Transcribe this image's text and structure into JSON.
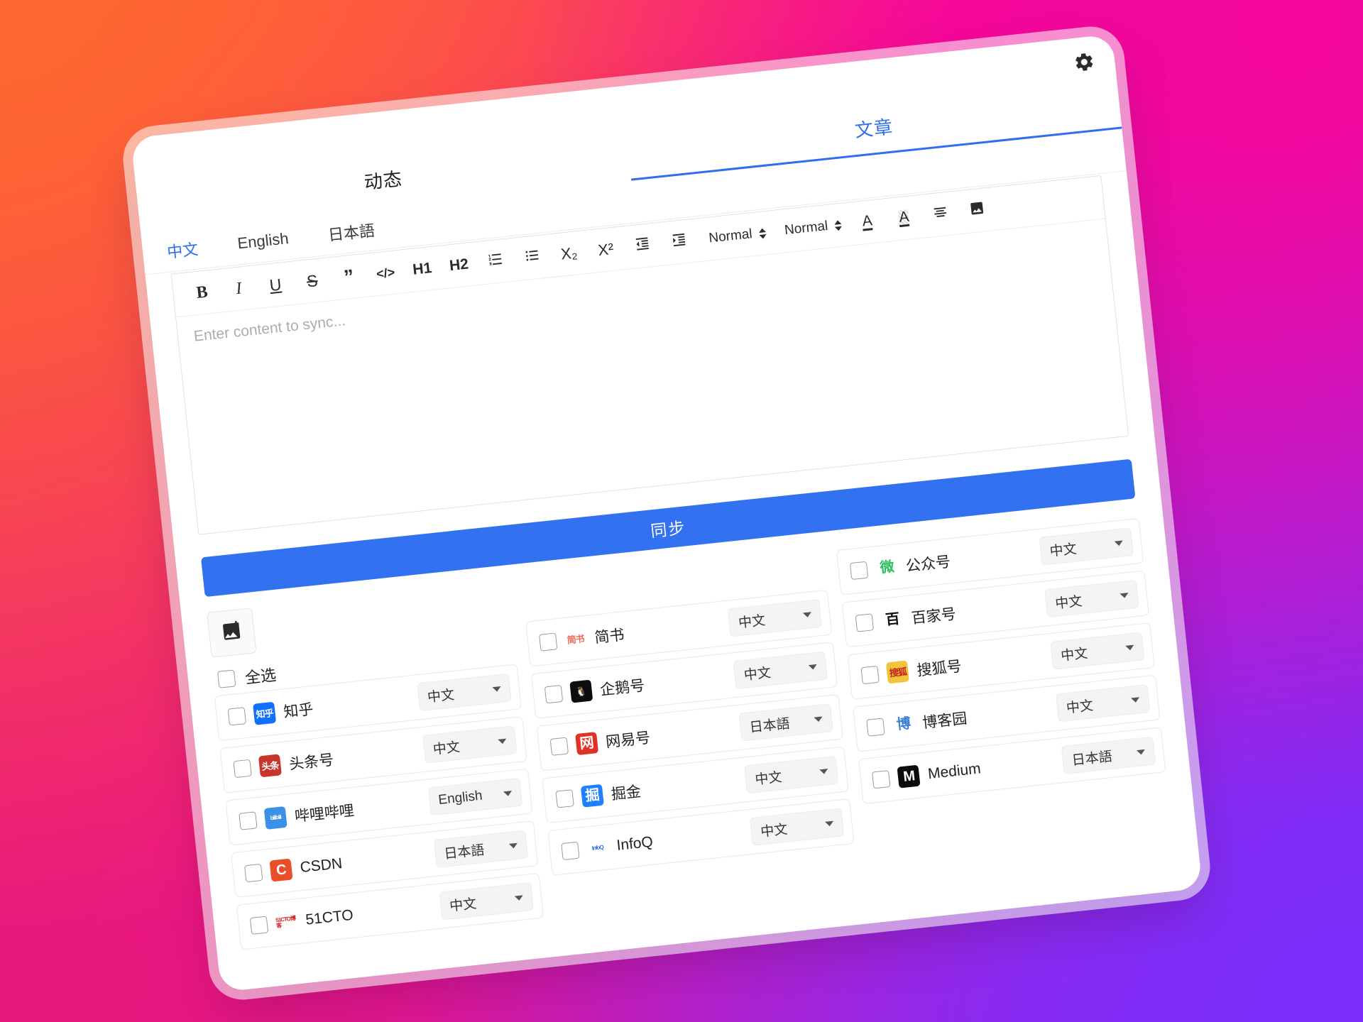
{
  "window": {
    "gear_icon": "gear-icon"
  },
  "tabs": [
    {
      "label": "动态",
      "active": false
    },
    {
      "label": "文章",
      "active": true
    }
  ],
  "languages": [
    {
      "label": "中文",
      "active": true
    },
    {
      "label": "English",
      "active": false
    },
    {
      "label": "日本語",
      "active": false
    }
  ],
  "toolbar": {
    "row1": [
      {
        "name": "ordered-list-icon",
        "label": ""
      },
      {
        "name": "bullet-list-icon",
        "label": ""
      },
      {
        "name": "subscript-icon",
        "label": "X₂"
      },
      {
        "name": "superscript-icon",
        "label": "X²"
      },
      {
        "name": "outdent-icon",
        "label": ""
      },
      {
        "name": "indent-icon",
        "label": ""
      }
    ],
    "heading_picker": "Normal",
    "font_picker": "Normal",
    "bold": "B",
    "italic": "I",
    "underline": "U",
    "strike": "S",
    "quote": "”",
    "code": "</>",
    "h1": "H1",
    "h2": "H2",
    "color": "A",
    "highlight": "A",
    "align": "align-icon",
    "image": "image-icon"
  },
  "editor": {
    "placeholder": "Enter content to sync..."
  },
  "sync_button": {
    "label": "同步"
  },
  "add_image_button": {
    "icon": "add-image-icon"
  },
  "select_all": {
    "label": "全选",
    "checked": false
  },
  "colors": {
    "accent": "#3272f0",
    "bg_orange": "#FF6630",
    "bg_pink": "#F5069A",
    "bg_purple": "#7C2EFA"
  },
  "platforms": {
    "column1": [
      {
        "name": "知乎",
        "lang": "中文",
        "logo_text": "知乎",
        "logo_bg": "#0f6fff",
        "logo_fg": "#ffffff",
        "checked": false
      },
      {
        "name": "头条号",
        "lang": "中文",
        "logo_text": "头条",
        "logo_bg": "#c7352c",
        "logo_fg": "#ffffff",
        "checked": false
      },
      {
        "name": "哔哩哔哩",
        "lang": "English",
        "logo_text": "bilibili",
        "logo_bg": "#3b90e8",
        "logo_fg": "#ffffff",
        "checked": false
      },
      {
        "name": "CSDN",
        "lang": "日本語",
        "logo_text": "C",
        "logo_bg": "#eb4f2a",
        "logo_fg": "#ffffff",
        "checked": false
      },
      {
        "name": "51CTO",
        "lang": "中文",
        "logo_text": "51CTO博客",
        "logo_bg": "#ffffff",
        "logo_fg": "#d32020",
        "checked": false
      }
    ],
    "column2": [
      {
        "name": "简书",
        "lang": "中文",
        "logo_text": "简书",
        "logo_bg": "#ffffff",
        "logo_fg": "#ea6f5a",
        "checked": false
      },
      {
        "name": "企鹅号",
        "lang": "中文",
        "logo_text": "🐧",
        "logo_bg": "#0d0d0d",
        "logo_fg": "#f5c430",
        "checked": false
      },
      {
        "name": "网易号",
        "lang": "日本語",
        "logo_text": "网",
        "logo_bg": "#e03127",
        "logo_fg": "#ffffff",
        "checked": false
      },
      {
        "name": "掘金",
        "lang": "中文",
        "logo_text": "掘",
        "logo_bg": "#1e80ff",
        "logo_fg": "#ffffff",
        "checked": false
      },
      {
        "name": "InfoQ",
        "lang": "中文",
        "logo_text": "InfoQ",
        "logo_bg": "#ffffff",
        "logo_fg": "#2f6ef0",
        "checked": false
      }
    ],
    "column3": [
      {
        "name": "公众号",
        "lang": "中文",
        "logo_text": "微",
        "logo_bg": "#ffffff",
        "logo_fg": "#2dbe5f",
        "checked": false
      },
      {
        "name": "百家号",
        "lang": "中文",
        "logo_text": "百",
        "logo_bg": "#ffffff",
        "logo_fg": "#101010",
        "checked": false
      },
      {
        "name": "搜狐号",
        "lang": "中文",
        "logo_text": "搜狐",
        "logo_bg": "#f2c43a",
        "logo_fg": "#c22020",
        "checked": false
      },
      {
        "name": "博客园",
        "lang": "中文",
        "logo_text": "博",
        "logo_bg": "#ffffff",
        "logo_fg": "#3a7fd5",
        "checked": false
      },
      {
        "name": "Medium",
        "lang": "日本語",
        "logo_text": "M",
        "logo_bg": "#0b0b0b",
        "logo_fg": "#ffffff",
        "checked": false
      }
    ]
  }
}
